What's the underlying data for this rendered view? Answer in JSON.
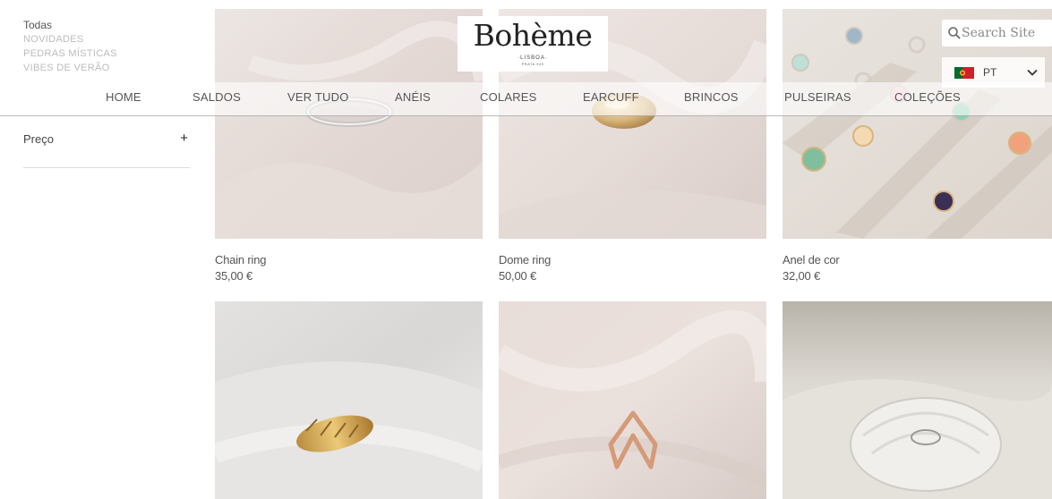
{
  "sidebar": {
    "categories": [
      "Todas",
      "NOVIDADES",
      "PEDRAS MÍSTICAS",
      "VIBES DE VERÃO"
    ],
    "filter_label": "Preço",
    "filter_toggle": "+"
  },
  "header": {
    "logo": {
      "name": "Bohème",
      "tagline": "·LISBOA·",
      "subline": "PRATA 925"
    },
    "nav": [
      "HOME",
      "SALDOS",
      "VER TUDO",
      "ANÉIS",
      "COLARES",
      "EARCUFF",
      "BRINCOS",
      "PULSEIRAS",
      "COLEÇÕES"
    ],
    "search_placeholder": "Search Site",
    "language": {
      "code": "PT",
      "flag_icon": "portugal-flag-icon"
    }
  },
  "products": [
    {
      "name": "Chain ring",
      "price": "35,00 €"
    },
    {
      "name": "Dome ring",
      "price": "50,00 €"
    },
    {
      "name": "Anel de cor",
      "price": "32,00 €"
    },
    {
      "name": "",
      "price": ""
    },
    {
      "name": "",
      "price": ""
    },
    {
      "name": "",
      "price": ""
    }
  ],
  "colors": {
    "text": "#555555",
    "muted": "#bcbcbc",
    "background": "#ffffff"
  }
}
